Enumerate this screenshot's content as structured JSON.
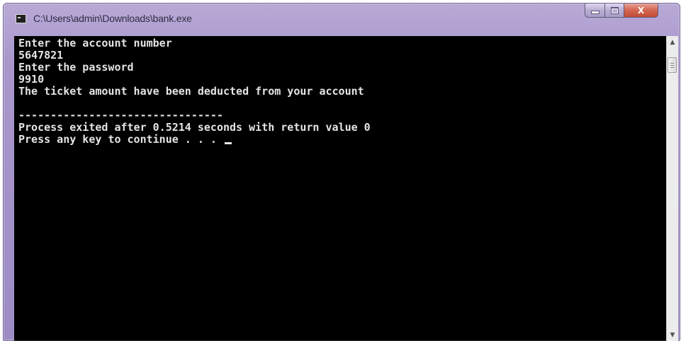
{
  "window": {
    "title": "C:\\Users\\admin\\Downloads\\bank.exe",
    "icon": "console-app-icon",
    "controls": {
      "minimize_icon": "minimize-icon",
      "maximize_icon": "maximize-icon",
      "close_label": "X"
    }
  },
  "console": {
    "lines": [
      "Enter the account number",
      "5647821",
      "Enter the password",
      "9910",
      "The ticket amount have been deducted from your account",
      "",
      "--------------------------------",
      "Process exited after 0.5214 seconds with return value 0",
      "Press any key to continue . . . "
    ],
    "colors": {
      "background": "#000000",
      "text": "#e4e4e4"
    }
  },
  "scrollbar": {
    "up_icon": "scroll-up-arrow-icon",
    "down_icon": "scroll-down-arrow-icon",
    "up_glyph": "▲",
    "down_glyph": "▼"
  }
}
